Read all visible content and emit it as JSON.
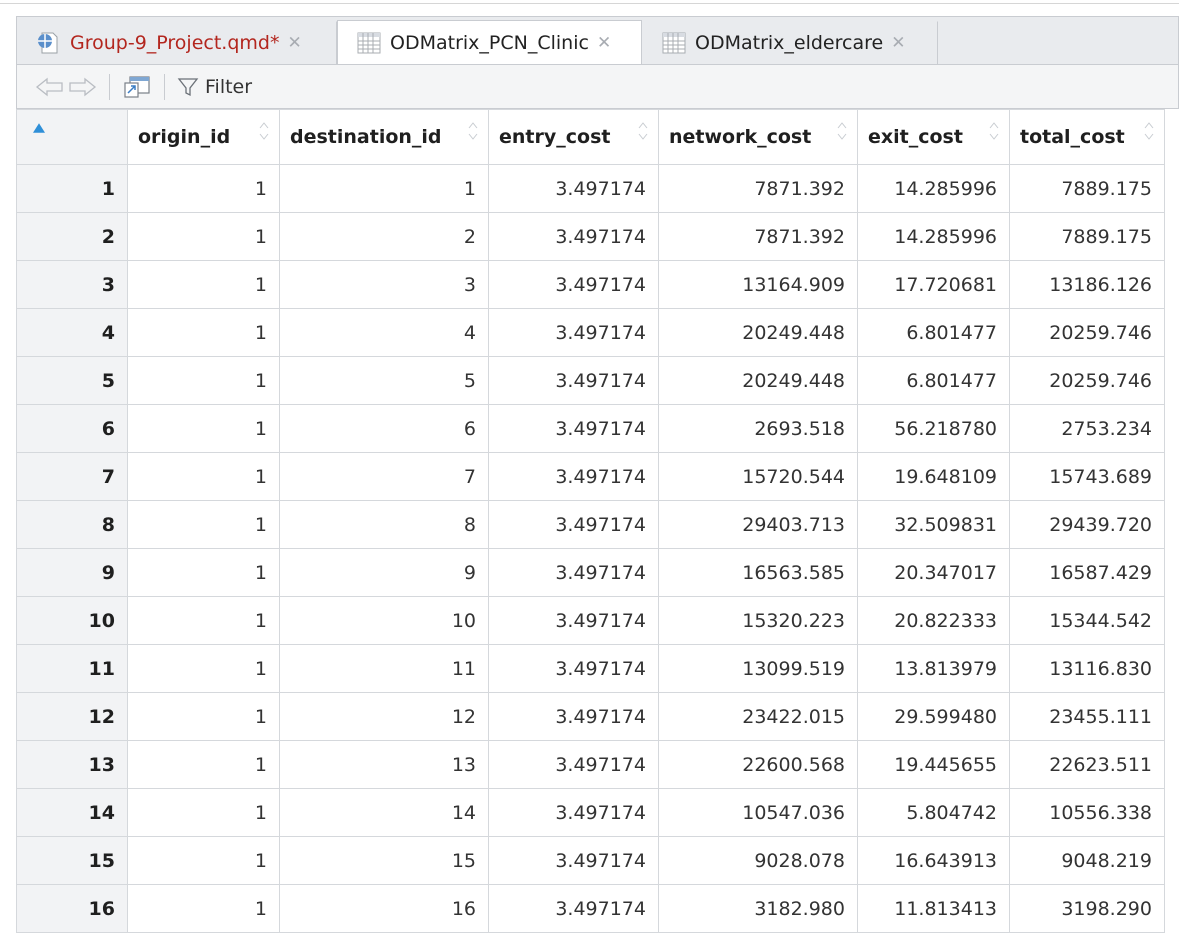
{
  "tabs": [
    {
      "label": "Group-9_Project.qmd*",
      "icon": "quarto-document-icon",
      "active": false,
      "label_color": "#b3261e"
    },
    {
      "label": "ODMatrix_PCN_Clinic",
      "icon": "data-grid-icon",
      "active": true,
      "label_color": "#222222"
    },
    {
      "label": "ODMatrix_eldercare",
      "icon": "data-grid-icon",
      "active": false,
      "label_color": "#222222"
    }
  ],
  "toolbar": {
    "filter_label": "Filter",
    "icons": [
      "back-arrow-icon",
      "forward-arrow-icon",
      "show-in-window-icon",
      "filter-funnel-icon"
    ]
  },
  "table": {
    "columns": [
      "origin_id",
      "destination_id",
      "entry_cost",
      "network_cost",
      "exit_cost",
      "total_cost"
    ],
    "sorted_column": "row-number",
    "rows": [
      [
        "1",
        "1",
        "1",
        "3.497174",
        "7871.392",
        "14.285996",
        "7889.175"
      ],
      [
        "2",
        "1",
        "2",
        "3.497174",
        "7871.392",
        "14.285996",
        "7889.175"
      ],
      [
        "3",
        "1",
        "3",
        "3.497174",
        "13164.909",
        "17.720681",
        "13186.126"
      ],
      [
        "4",
        "1",
        "4",
        "3.497174",
        "20249.448",
        "6.801477",
        "20259.746"
      ],
      [
        "5",
        "1",
        "5",
        "3.497174",
        "20249.448",
        "6.801477",
        "20259.746"
      ],
      [
        "6",
        "1",
        "6",
        "3.497174",
        "2693.518",
        "56.218780",
        "2753.234"
      ],
      [
        "7",
        "1",
        "7",
        "3.497174",
        "15720.544",
        "19.648109",
        "15743.689"
      ],
      [
        "8",
        "1",
        "8",
        "3.497174",
        "29403.713",
        "32.509831",
        "29439.720"
      ],
      [
        "9",
        "1",
        "9",
        "3.497174",
        "16563.585",
        "20.347017",
        "16587.429"
      ],
      [
        "10",
        "1",
        "10",
        "3.497174",
        "15320.223",
        "20.822333",
        "15344.542"
      ],
      [
        "11",
        "1",
        "11",
        "3.497174",
        "13099.519",
        "13.813979",
        "13116.830"
      ],
      [
        "12",
        "1",
        "12",
        "3.497174",
        "23422.015",
        "29.599480",
        "23455.111"
      ],
      [
        "13",
        "1",
        "13",
        "3.497174",
        "22600.568",
        "19.445655",
        "22623.511"
      ],
      [
        "14",
        "1",
        "14",
        "3.497174",
        "10547.036",
        "5.804742",
        "10556.338"
      ],
      [
        "15",
        "1",
        "15",
        "3.497174",
        "9028.078",
        "16.643913",
        "9048.219"
      ],
      [
        "16",
        "1",
        "16",
        "3.497174",
        "3182.980",
        "11.813413",
        "3198.290"
      ]
    ]
  },
  "colors": {
    "accent_sort": "#2f8fd8",
    "modified_tab_text": "#b3261e"
  }
}
